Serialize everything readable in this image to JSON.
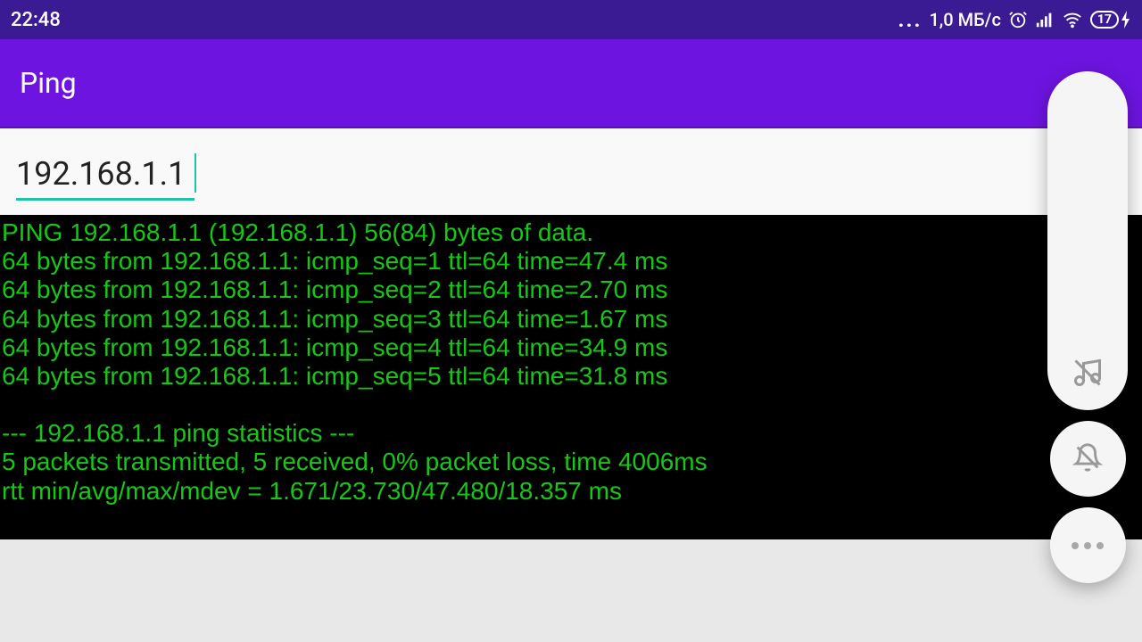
{
  "statusBar": {
    "time": "22:48",
    "netSpeed": "1,0 МБ/с",
    "batteryPercent": "17"
  },
  "appBar": {
    "title": "Ping"
  },
  "input": {
    "value": "192.168.1.1"
  },
  "terminal": {
    "lines": [
      "PING 192.168.1.1 (192.168.1.1) 56(84) bytes of data.",
      "64 bytes from 192.168.1.1: icmp_seq=1 ttl=64 time=47.4 ms",
      "64 bytes from 192.168.1.1: icmp_seq=2 ttl=64 time=2.70 ms",
      "64 bytes from 192.168.1.1: icmp_seq=3 ttl=64 time=1.67 ms",
      "64 bytes from 192.168.1.1: icmp_seq=4 ttl=64 time=34.9 ms",
      "64 bytes from 192.168.1.1: icmp_seq=5 ttl=64 time=31.8 ms"
    ],
    "statsHeader": "--- 192.168.1.1 ping statistics ---",
    "statsLine1": "5 packets transmitted, 5 received, 0% packet loss, time 4006ms",
    "statsLine2": "rtt min/avg/max/mdev = 1.671/23.730/47.480/18.357 ms"
  }
}
